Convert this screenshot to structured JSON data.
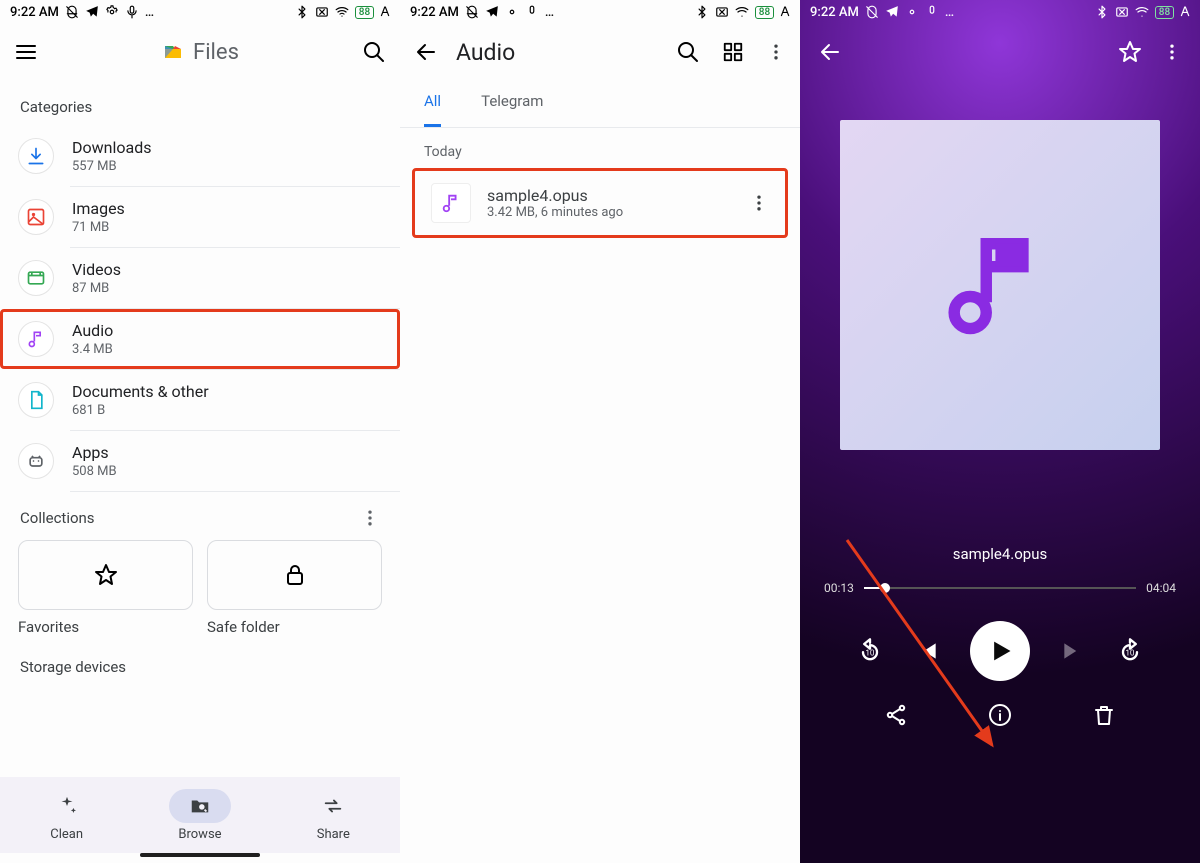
{
  "status": {
    "time": "9:22 AM",
    "battery": "88"
  },
  "pane1": {
    "title": "Files",
    "section_categories": "Categories",
    "categories": [
      {
        "name": "Downloads",
        "sub": "557 MB"
      },
      {
        "name": "Images",
        "sub": "71 MB"
      },
      {
        "name": "Videos",
        "sub": "87 MB"
      },
      {
        "name": "Audio",
        "sub": "3.4 MB"
      },
      {
        "name": "Documents & other",
        "sub": "681 B"
      },
      {
        "name": "Apps",
        "sub": "508 MB"
      }
    ],
    "section_collections": "Collections",
    "tiles": {
      "favorites": "Favorites",
      "safe": "Safe folder"
    },
    "section_storage": "Storage devices",
    "nav": {
      "clean": "Clean",
      "browse": "Browse",
      "share": "Share"
    }
  },
  "pane2": {
    "title": "Audio",
    "tabs": [
      "All",
      "Telegram"
    ],
    "group": "Today",
    "file": {
      "name": "sample4.opus",
      "sub": "3.42 MB, 6 minutes ago"
    }
  },
  "pane3": {
    "track_name": "sample4.opus",
    "time_current": "00:13",
    "time_total": "04:04"
  }
}
